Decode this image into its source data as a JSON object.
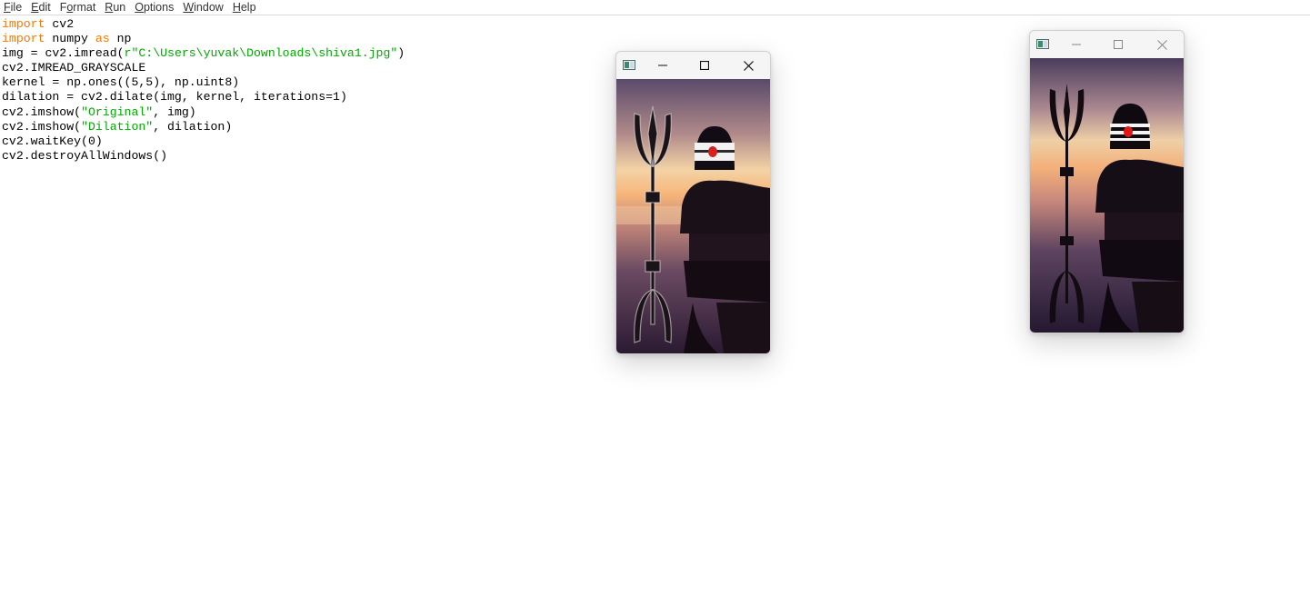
{
  "menu": {
    "items": [
      {
        "accel": "F",
        "rest": "ile"
      },
      {
        "accel": "E",
        "rest": "dit"
      },
      {
        "pre": "F",
        "accel": "o",
        "rest": "rmat"
      },
      {
        "accel": "R",
        "rest": "un"
      },
      {
        "accel": "O",
        "rest": "ptions"
      },
      {
        "accel": "W",
        "rest": "indow"
      },
      {
        "accel": "H",
        "rest": "elp"
      }
    ]
  },
  "code": {
    "lines": [
      [
        {
          "t": "import",
          "c": "kw"
        },
        {
          "t": " cv2"
        }
      ],
      [
        {
          "t": "import",
          "c": "kw"
        },
        {
          "t": " numpy "
        },
        {
          "t": "as",
          "c": "kw"
        },
        {
          "t": " np"
        }
      ],
      [
        {
          "t": "img = cv2.imread("
        },
        {
          "t": "r\"C:\\Users\\yuvak\\Downloads\\shiva1.jpg\"",
          "c": "str"
        },
        {
          "t": ")"
        }
      ],
      [
        {
          "t": "cv2.IMREAD_GRAYSCALE"
        }
      ],
      [
        {
          "t": "kernel = np.ones((5,5), np.uint8)"
        }
      ],
      [
        {
          "t": "dilation = cv2.dilate(img, kernel, iterations=1)"
        }
      ],
      [
        {
          "t": "cv2.imshow("
        },
        {
          "t": "\"Original\"",
          "c": "str"
        },
        {
          "t": ", img)"
        }
      ],
      [
        {
          "t": "cv2.imshow("
        },
        {
          "t": "\"Dilation\"",
          "c": "str"
        },
        {
          "t": ", dilation)"
        }
      ],
      [
        {
          "t": "cv2.waitKey(0)"
        }
      ],
      [
        {
          "t": "cv2.destroyAllWindows()"
        }
      ]
    ]
  },
  "windows": [
    {
      "id": "dilation-window",
      "image": "dilated shiva lingam with trident at sunset",
      "focused": true
    },
    {
      "id": "original-window",
      "image": "shiva lingam with trident at sunset",
      "focused": false
    }
  ],
  "colors": {
    "keyword": "#ff7700",
    "string": "#00aa00",
    "text": "#000000"
  },
  "icons": {
    "app": "opencv-window-icon",
    "minimize": "minimize-icon",
    "maximize": "maximize-icon",
    "close": "close-icon"
  }
}
